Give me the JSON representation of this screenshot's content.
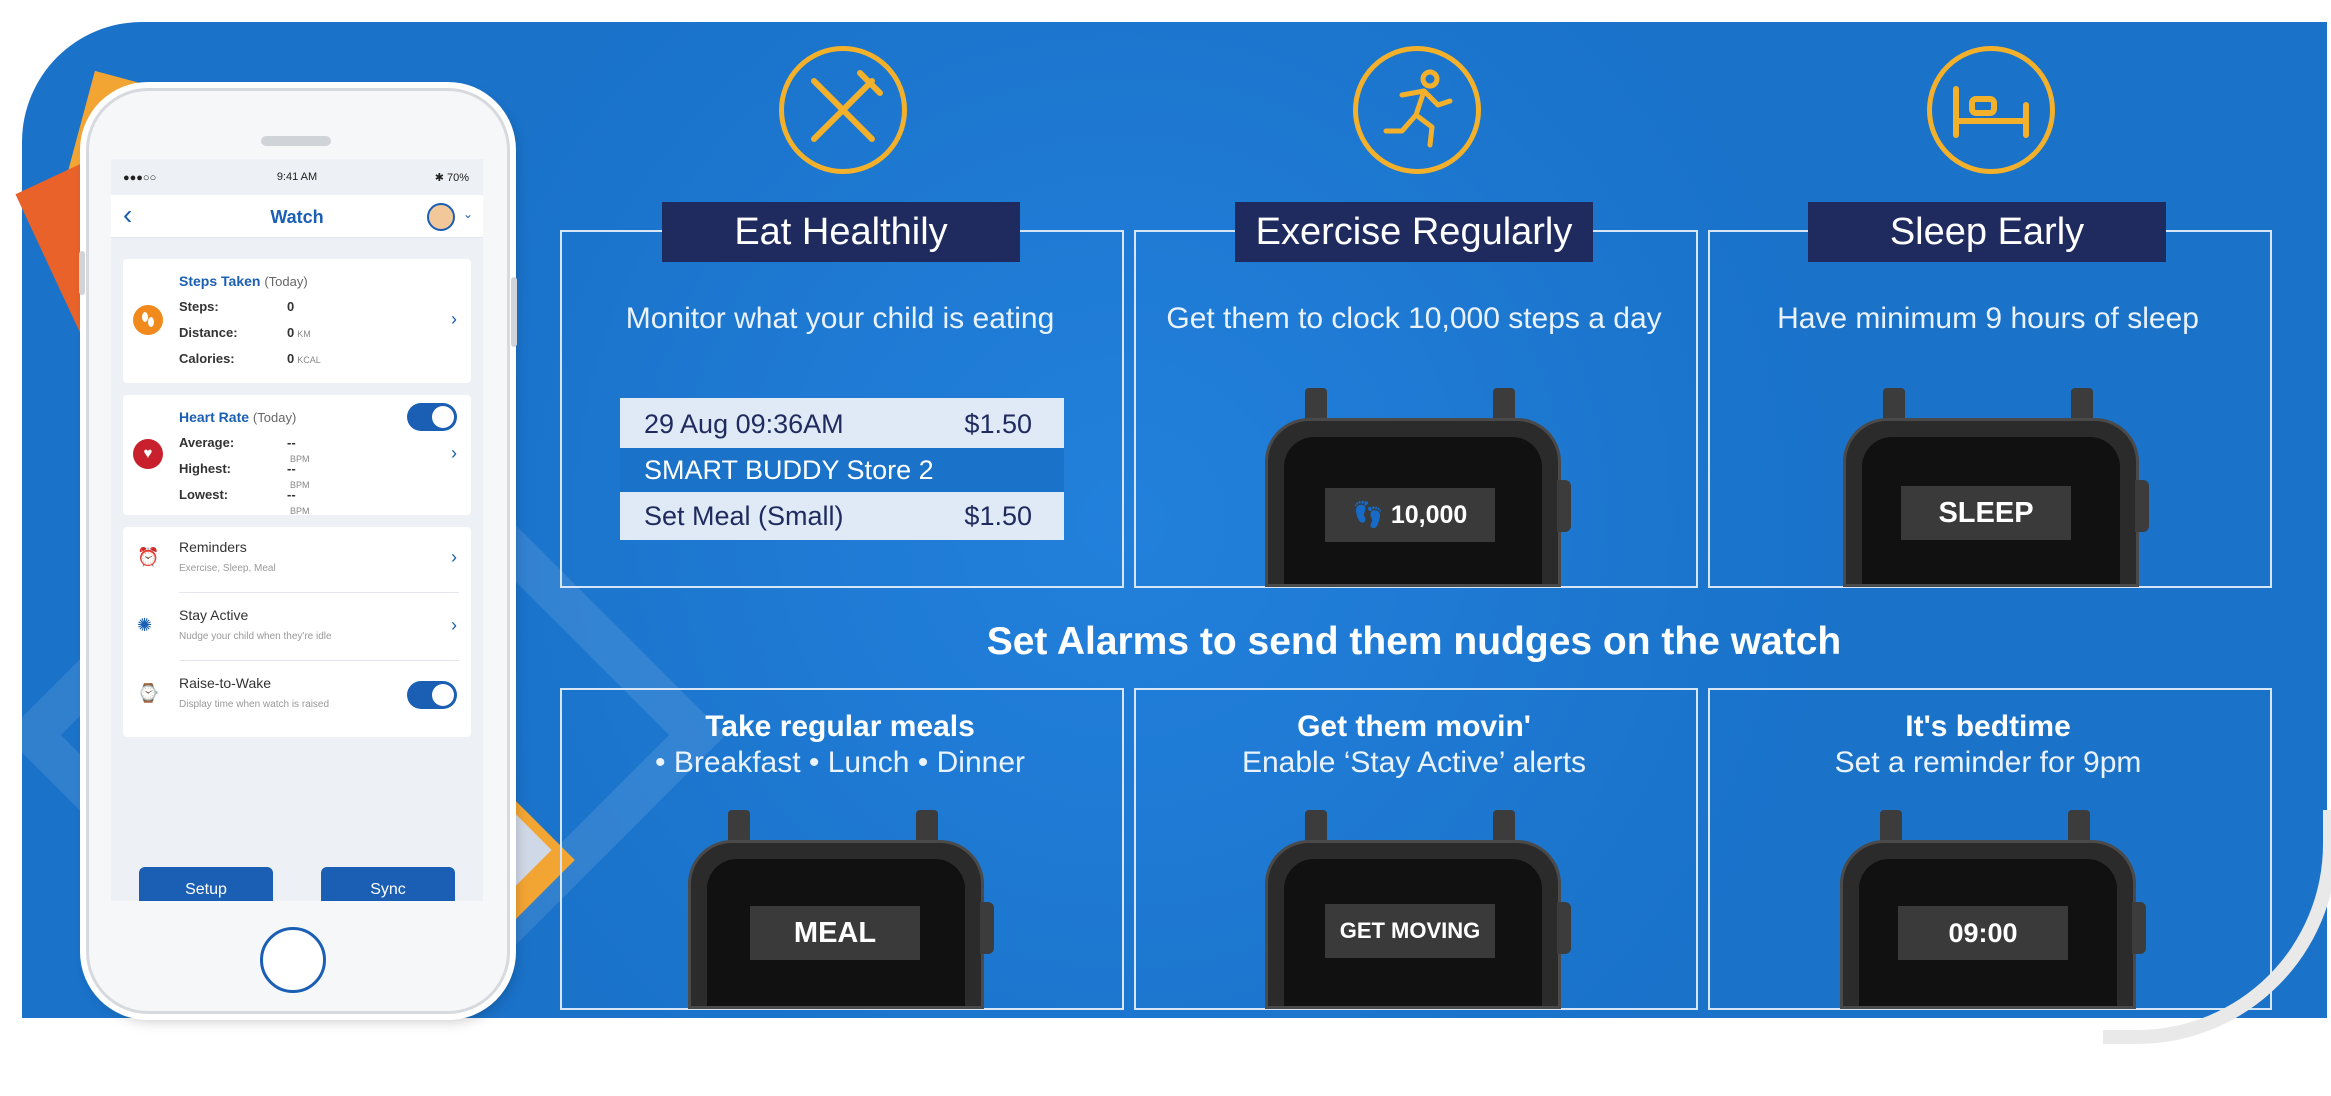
{
  "phone": {
    "status": {
      "signal": "●●●○○",
      "time": "9:41 AM",
      "battery": "✱ 70%"
    },
    "nav": {
      "back": "‹",
      "title": "Watch",
      "caret": "⌄"
    },
    "steps_card": {
      "title": "Steps Taken",
      "title_sub": "(Today)",
      "rows": [
        {
          "label": "Steps:",
          "value": "0",
          "unit": ""
        },
        {
          "label": "Distance:",
          "value": "0",
          "unit": "KM"
        },
        {
          "label": "Calories:",
          "value": "0",
          "unit": "KCAL"
        }
      ],
      "icon": "footprint-icon"
    },
    "heart_card": {
      "title": "Heart Rate",
      "title_sub": "(Today)",
      "toggle_on": true,
      "rows": [
        {
          "label": "Average:",
          "value": "--",
          "unit": "BPM"
        },
        {
          "label": "Highest:",
          "value": "--",
          "unit": "BPM"
        },
        {
          "label": "Lowest:",
          "value": "--",
          "unit": "BPM"
        }
      ],
      "icon": "heart-icon"
    },
    "list": [
      {
        "title": "Reminders",
        "subtitle": "Exercise, Sleep, Meal",
        "icon": "alarm-icon",
        "control": "chevron"
      },
      {
        "title": "Stay Active",
        "subtitle": "Nudge your child when they're idle",
        "icon": "running-icon",
        "control": "chevron"
      },
      {
        "title": "Raise-to-Wake",
        "subtitle": "Display time when watch is raised",
        "icon": "wrist-icon",
        "control": "toggle"
      }
    ],
    "buttons": {
      "setup": "Setup",
      "sync": "Sync"
    },
    "tabbar": [
      "home-icon",
      "news-icon",
      "facebook-icon",
      "store-icon",
      "menu-icon"
    ]
  },
  "columns": [
    {
      "icon": "fork-knife-icon",
      "banner": "Eat Healthily",
      "subtitle": "Monitor what your child is eating",
      "receipt": [
        {
          "left": "29 Aug 09:36AM",
          "right": "$1.50"
        },
        {
          "left": "SMART BUDDY Store 2",
          "right": ""
        },
        {
          "left": "Set Meal (Small)",
          "right": "$1.50"
        }
      ]
    },
    {
      "icon": "runner-icon",
      "banner": "Exercise Regularly",
      "subtitle": "Get them to clock 10,000 steps a day",
      "watch_label": "10,000"
    },
    {
      "icon": "bed-icon",
      "banner": "Sleep Early",
      "subtitle": "Have minimum 9 hours of sleep",
      "watch_label": "SLEEP"
    }
  ],
  "headline": "Set Alarms to send them nudges on the watch",
  "alarms": [
    {
      "title": "Take regular meals",
      "subtitle": "• Breakfast • Lunch • Dinner",
      "watch_label": "MEAL"
    },
    {
      "title": "Get them movin'",
      "subtitle": "Enable ‘Stay Active’ alerts",
      "watch_label": "GET MOVING"
    },
    {
      "title": "It's bedtime",
      "subtitle": "Set a reminder for 9pm",
      "watch_label": "09:00"
    }
  ],
  "colors": {
    "background": "#1a72c9",
    "banner": "#1f2a5e",
    "accent": "#f3b02a",
    "app_blue": "#1a5fb4"
  }
}
